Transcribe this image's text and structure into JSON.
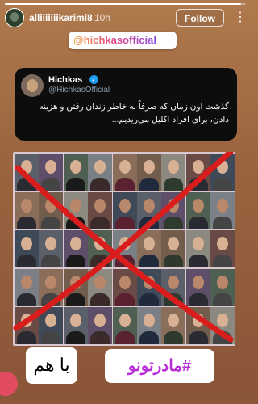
{
  "story": {
    "progress": 0.98,
    "username": "alliiiiiiikarimi8",
    "time_ago": "10h",
    "follow_label": "Follow",
    "more_icon": "more-vertical-icon"
  },
  "mention": {
    "text": "@hichkasofficial"
  },
  "tweet": {
    "name": "Hichkas",
    "handle": "@HichkasOfficial",
    "verified_icon": "verified-badge-icon",
    "text": "گذشت اون زمان که صرفاً به خاطر زندان رفتن و هزینه دادن، برای افراد اکلیل می‌ریدیم..."
  },
  "photo_grid": {
    "rows": 5,
    "cols": 9,
    "cross_color": "#d91d1d"
  },
  "stickers": {
    "left_text": "با هم",
    "right_text": "#مادرتونو"
  },
  "colors": {
    "background": "#9a6440",
    "tweet_bg": "#0d0d0d",
    "hashtag": "#b82fd8",
    "verified": "#1d9bf0"
  }
}
